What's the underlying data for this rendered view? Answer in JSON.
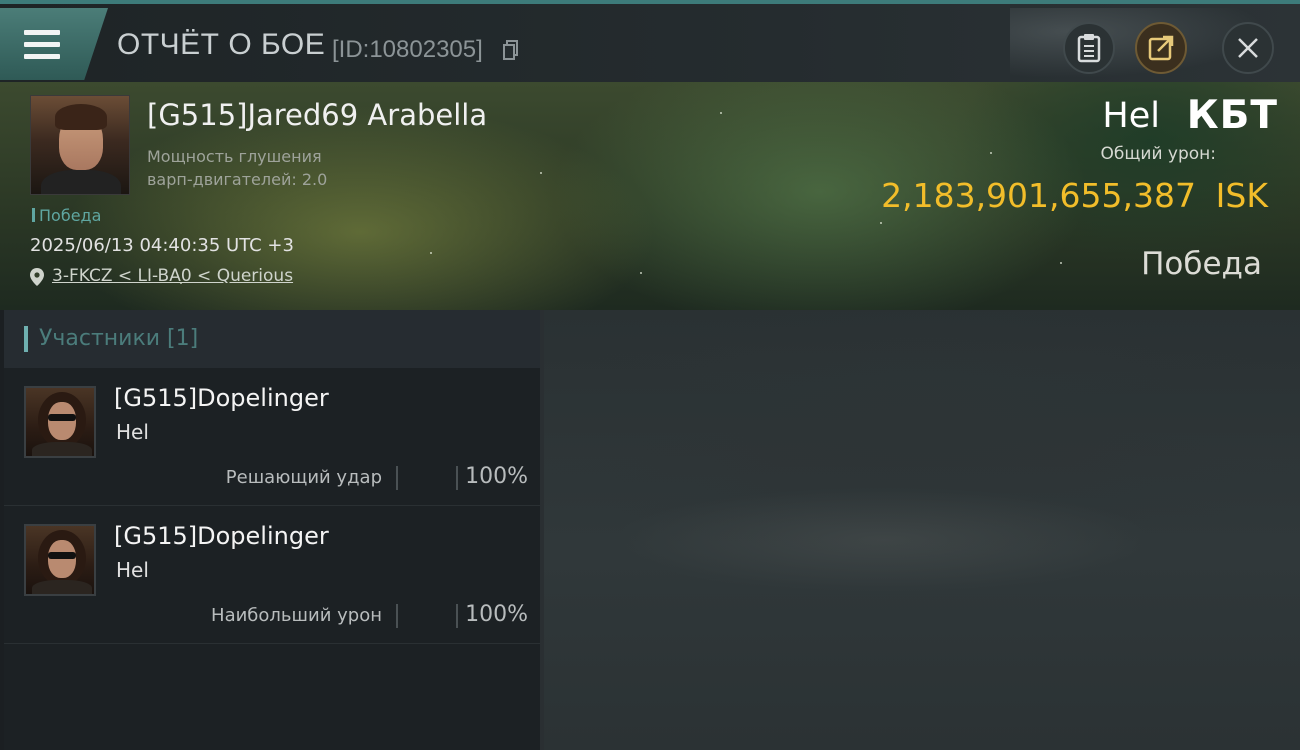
{
  "header": {
    "title": "ОТЧЁТ О БОЕ",
    "battle_id": "[ID:10802305]"
  },
  "hero": {
    "pilot_name": "[G515]Jared69 Arabella",
    "stat_line1": "Мощность глушения",
    "stat_line2": "варп-двигателей: 2.0",
    "result_small": "Победа",
    "datetime": "2025/06/13 04:40:35 UTC +3",
    "location": "3-FKCZ < LI-BA0 < Querious",
    "ship_name": "Hel",
    "ship_class": "КБТ",
    "damage_label": "Общий урон:",
    "damage_value": "2,183,901,655,387",
    "damage_unit": "ISK",
    "result_big": "Победа"
  },
  "participants": {
    "title": "Участники [1]",
    "rows": [
      {
        "name": "[G515]Dopelinger",
        "ship": "Hel",
        "role": "Решающий удар",
        "percent": "100%"
      },
      {
        "name": "[G515]Dopelinger",
        "ship": "Hel",
        "role": "Наибольший урон",
        "percent": "100%"
      }
    ]
  },
  "colors": {
    "accent": "#3d7b7a",
    "isk_gold": "#f2bd2a",
    "teal_text": "#5fa6a1"
  },
  "icons": [
    "menu-icon",
    "copy-icon",
    "clipboard-icon",
    "share-icon",
    "close-icon",
    "location-pin-icon"
  ]
}
